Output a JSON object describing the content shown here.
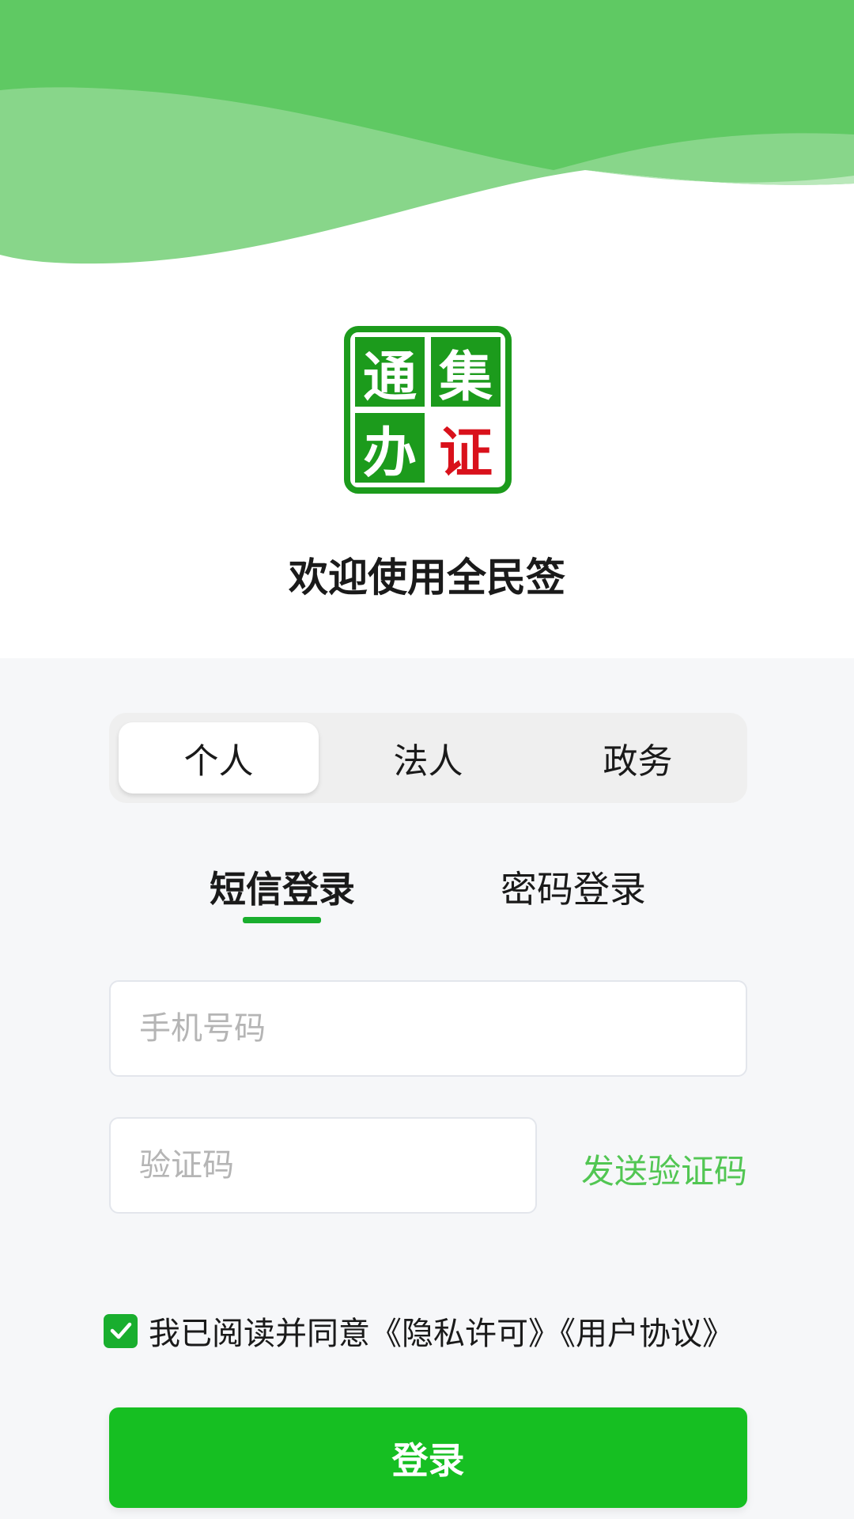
{
  "logo": {
    "chars": [
      "通",
      "集",
      "办",
      "证"
    ],
    "colors": {
      "green": "#1c9b1c",
      "red": "#d9111b"
    }
  },
  "welcome": {
    "title": "欢迎使用全民签"
  },
  "account_types": {
    "items": [
      "个人",
      "法人",
      "政务"
    ],
    "selected": "个人"
  },
  "login_tabs": {
    "sms": "短信登录",
    "password": "密码登录",
    "active": "短信登录"
  },
  "form": {
    "phone_placeholder": "手机号码",
    "phone_value": "",
    "code_placeholder": "验证码",
    "code_value": "",
    "send_code": "发送验证码"
  },
  "agreement": {
    "checked": true,
    "prefix": "我已阅读并同意",
    "privacy": "《隐私许可》",
    "terms": "《用户协议》"
  },
  "login_button": {
    "label": "登录"
  },
  "colors": {
    "accent_green": "#19ae2e",
    "button_green": "#16bf22",
    "link_green": "#52c653",
    "wave_green": "#5fc963"
  }
}
